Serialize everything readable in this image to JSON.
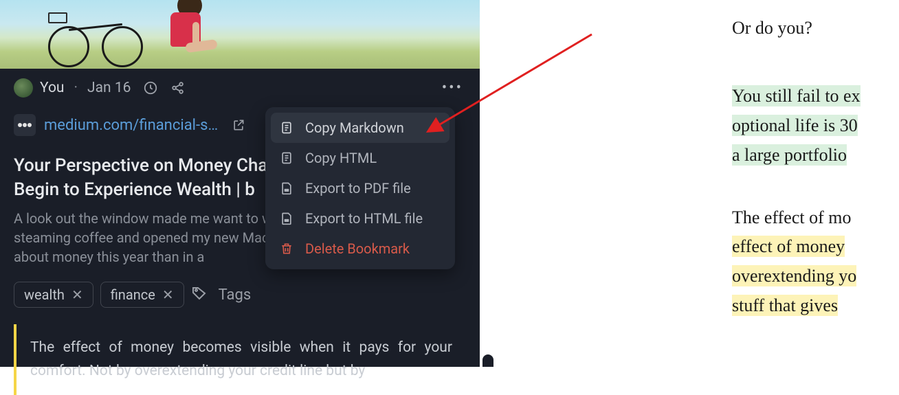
{
  "card": {
    "author": "You",
    "date": "Jan 16",
    "url_display": "medium.com/financial-s…",
    "title": "Your Perspective on Money Changes When You Begin to Experience Wealth | b",
    "description": "A look out the window made me want to write. I poured some steaming coffee and opened my new MacBook. I learned more about money this year than in a",
    "tags": [
      "wealth",
      "finance"
    ],
    "tags_label": "Tags",
    "quote": "The effect of money becomes visible when it pays for your comfort. Not by overextending your credit line but by"
  },
  "menu": {
    "items": [
      {
        "label": "Copy Markdown",
        "highlighted": true,
        "danger": false
      },
      {
        "label": "Copy HTML",
        "highlighted": false,
        "danger": false
      },
      {
        "label": "Export to PDF file",
        "highlighted": false,
        "danger": false
      },
      {
        "label": "Export to HTML file",
        "highlighted": false,
        "danger": false
      },
      {
        "label": "Delete Bookmark",
        "highlighted": false,
        "danger": true
      }
    ]
  },
  "reader": {
    "p1": "Or do you?",
    "p2_l1": "You still fail to ex",
    "p2_l2": "optional life is 30",
    "p2_l3": "a large portfolio",
    "p3_l1": "The effect of mo",
    "p3_l2": "effect of money",
    "p3_l3": "overextending yo",
    "p3_l4": "stuff that gives"
  }
}
